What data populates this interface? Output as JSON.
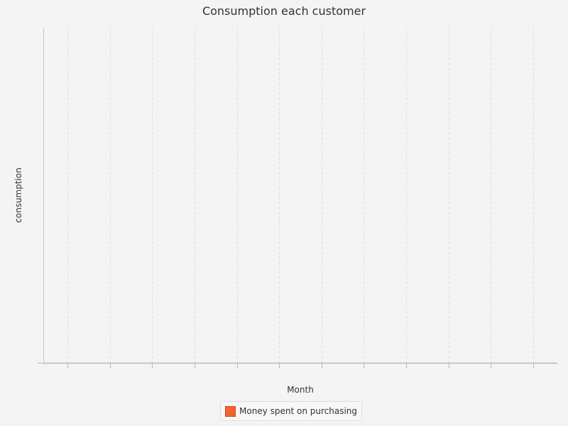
{
  "chart_data": {
    "type": "bar",
    "title": "Consumption each customer",
    "xlabel": "Month",
    "ylabel": "consumption",
    "categories": [],
    "category_count": 12,
    "series": [
      {
        "name": "Money spent on purchasing",
        "color": "#f4622e",
        "values": []
      }
    ],
    "grid": {
      "vertical": true,
      "horizontal": false,
      "style": "dashed"
    },
    "legend": "bottom-center"
  }
}
